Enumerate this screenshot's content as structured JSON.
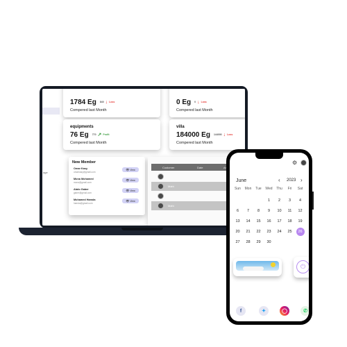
{
  "laptop": {
    "sidebar": {
      "partial_label": "age"
    },
    "cards": [
      {
        "title": "",
        "value": "1784 Eg",
        "prev_value": "840",
        "trend": "down",
        "trend_label": "Loss",
        "compare": "Compered last Month"
      },
      {
        "title": "",
        "value": "0 Eg",
        "prev_value": "0",
        "trend": "down",
        "trend_label": "Loss",
        "compare": "Compered last Month"
      },
      {
        "title": "equipments",
        "value": "76 Eg",
        "prev_value": "770",
        "trend": "up",
        "trend_label": "Profit",
        "compare": "Compered last Month"
      },
      {
        "title": "villa",
        "value": "184000 Eg",
        "prev_value": "144000",
        "trend": "down",
        "trend_label": "Loss",
        "compare": "Compered last Month"
      }
    ],
    "new_member": {
      "title": "New Member",
      "members": [
        {
          "name": "Omar Kasy",
          "email": "omarkasy@gmail.com",
          "action": "View"
        },
        {
          "name": "Mona Mohamed",
          "email": "mona@gmail.com",
          "action": "View"
        },
        {
          "name": "Abdo Gaber",
          "email": "gaber@gmail.com",
          "action": "View"
        },
        {
          "name": "Mohamed Hamda",
          "email": "hamda@gmail.com",
          "action": "View"
        }
      ]
    },
    "orders": {
      "columns": [
        "Customer",
        "Date",
        "Amount"
      ],
      "rows": [
        {
          "text": ""
        },
        {
          "text": "Mahi"
        },
        {
          "text": ""
        },
        {
          "text": "Mahi"
        }
      ]
    }
  },
  "phone": {
    "calendar": {
      "month": "June",
      "year": "2023",
      "weekdays": [
        "Sun",
        "Mon",
        "Tue",
        "Wed",
        "Thu",
        "Fri",
        "Sat"
      ],
      "days": [
        "",
        "",
        "",
        "1",
        "2",
        "3",
        "4",
        "6",
        "7",
        "8",
        "9",
        "10",
        "11",
        "12",
        "13",
        "14",
        "15",
        "16",
        "17",
        "18",
        "19",
        "20",
        "21",
        "22",
        "23",
        "24",
        "25",
        "26",
        "27",
        "28",
        "29",
        "30",
        "",
        "",
        ""
      ],
      "selected_day": "26",
      "accent": "#b887f0"
    },
    "socials": [
      "facebook-icon",
      "twitter-icon",
      "instagram-icon",
      "whatsapp-icon"
    ]
  },
  "colors": {
    "loss": "#e53935",
    "profit": "#43a047",
    "view_button": "#d2d2f5"
  }
}
